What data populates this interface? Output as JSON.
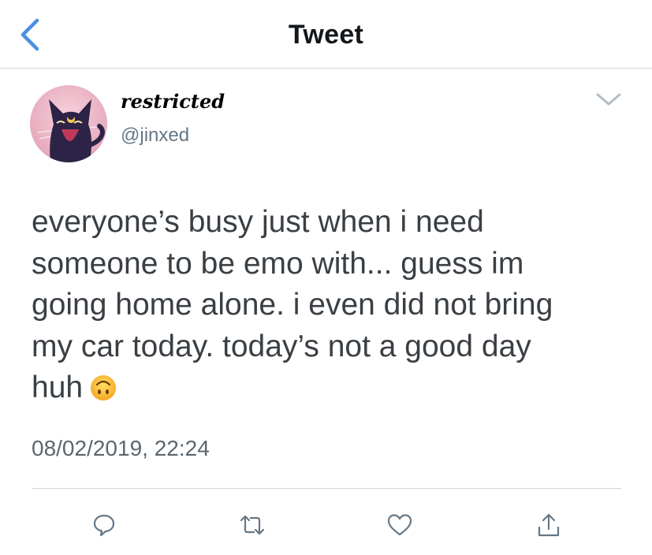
{
  "header": {
    "title": "Tweet",
    "back_icon": "chevron-left-icon",
    "accent_color": "#4a90e2"
  },
  "tweet": {
    "author": {
      "display_name": "restricted",
      "handle": "@jinxed",
      "avatar": "black-cat-avatar"
    },
    "text_lines": [
      "everyone’s busy just when i need",
      "someone to be emo with... guess im",
      "going home alone. i even did not bring",
      "my car today. today’s not a good day",
      "huh"
    ],
    "emoji": "upside-down-face",
    "timestamp": "08/02/2019, 22:24",
    "more_icon": "chevron-down-icon"
  },
  "actions": [
    {
      "name": "reply",
      "icon": "reply-icon"
    },
    {
      "name": "retweet",
      "icon": "retweet-icon"
    },
    {
      "name": "like",
      "icon": "heart-icon"
    },
    {
      "name": "share",
      "icon": "share-icon"
    }
  ],
  "colors": {
    "text": "#3a3f44",
    "secondary": "#657786",
    "divider": "#cfd3d6",
    "icon": "#657786"
  }
}
